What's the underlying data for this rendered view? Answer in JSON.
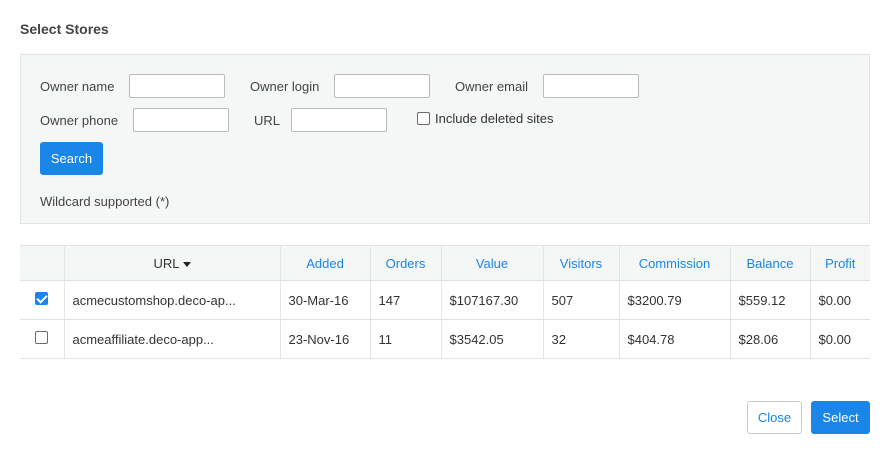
{
  "dialog": {
    "title": "Select Stores"
  },
  "filters": {
    "owner_name_label": "Owner name",
    "owner_name_value": "",
    "owner_login_label": "Owner login",
    "owner_login_value": "",
    "owner_email_label": "Owner email",
    "owner_email_value": "",
    "owner_phone_label": "Owner phone",
    "owner_phone_value": "",
    "url_label": "URL",
    "url_value": "",
    "include_deleted_label": "Include deleted sites",
    "include_deleted_checked": false,
    "search_button": "Search",
    "hint": "Wildcard supported (*)"
  },
  "table": {
    "columns": [
      "URL",
      "Added",
      "Orders",
      "Value",
      "Visitors",
      "Commission",
      "Balance",
      "Profit"
    ],
    "sort_column": "URL",
    "sort_icon": "caret-down-icon",
    "rows": [
      {
        "selected": true,
        "url": "acmecustomshop.deco-ap...",
        "added": "30-Mar-16",
        "orders": "147",
        "value": "$107167.30",
        "visitors": "507",
        "commission": "$3200.79",
        "balance": "$559.12",
        "profit": "$0.00"
      },
      {
        "selected": false,
        "url": "acmeaffiliate.deco-app...",
        "added": "23-Nov-16",
        "orders": "11",
        "value": "$3542.05",
        "visitors": "32",
        "commission": "$404.78",
        "balance": "$28.06",
        "profit": "$0.00"
      }
    ]
  },
  "footer": {
    "close_button": "Close",
    "select_button": "Select"
  },
  "colors": {
    "accent": "#1a86e8",
    "panel_bg": "#f5f6f6"
  }
}
